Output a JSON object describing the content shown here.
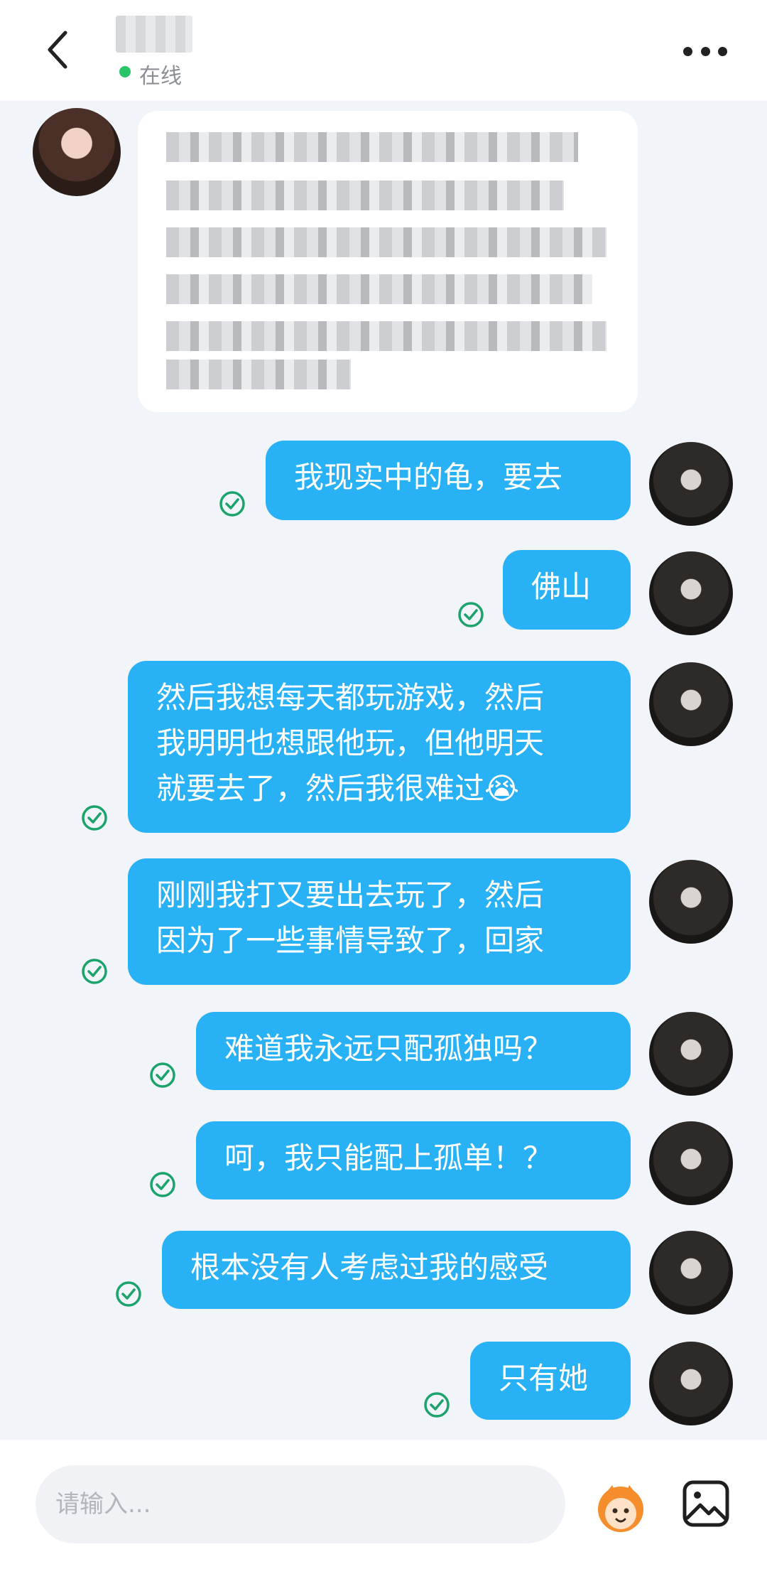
{
  "header": {
    "status": "在线",
    "back_icon": "back-arrow-icon",
    "more_icon": "more-dots-icon"
  },
  "messages": [
    {
      "text": "我现实中的龟，要去"
    },
    {
      "text": "佛山"
    },
    {
      "text": "然后我想每天都玩游戏，然后\n我明明也想跟他玩，但他明天\n就要去了，然后我很难过😭"
    },
    {
      "text": "刚刚我打又要出去玩了，然后\n因为了一些事情导致了，回家"
    },
    {
      "text": "难道我永远只配孤独吗？"
    },
    {
      "text": "呵，我只能配上孤单！？"
    },
    {
      "text": "根本没有人考虑过我的感受"
    },
    {
      "text": "只有她"
    }
  ],
  "input": {
    "placeholder": "请输入..."
  },
  "colors": {
    "bubble": "#29b1f5",
    "read_check": "#1aa36a",
    "online": "#29c36a",
    "background": "#f1f4f9"
  }
}
